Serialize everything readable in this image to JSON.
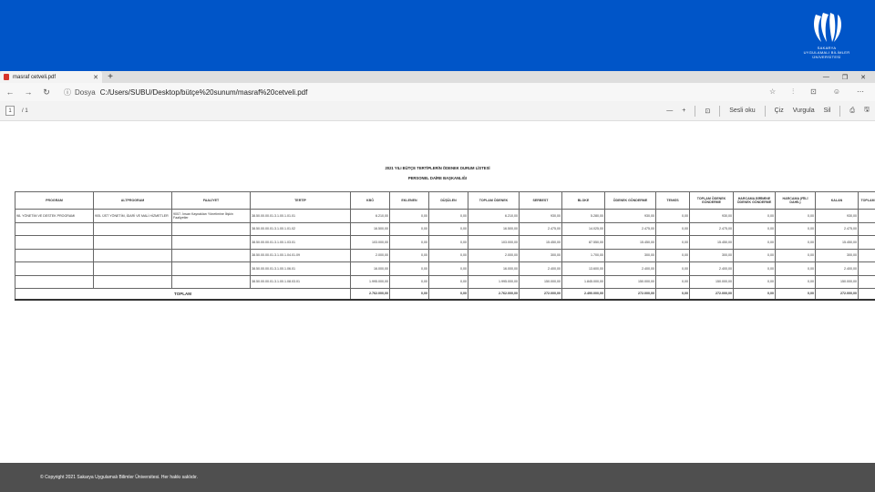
{
  "slide": {
    "logo_lines": [
      "SAKARYA",
      "UYGULAMALI BİLİMLER",
      "ÜNİVERSİTESİ"
    ],
    "footer": "© Copyright 2021 Sakarya Uygulamalı Bilimler Üniversitesi. Her hakkı saklıdır."
  },
  "browser": {
    "tab_title": "masraf cetveli.pdf",
    "tab_close": "✕",
    "new_tab": "+",
    "window_controls": [
      "—",
      "❐",
      "✕"
    ],
    "nav": {
      "back": "←",
      "forward": "→",
      "reload": "↻"
    },
    "url_info": "ⓘ",
    "url_protocol": "Dosya",
    "url": "C:/Users/SUBU/Desktop/bütçe%20sunum/masraf%20cetveli.pdf",
    "addr_icons": [
      "☆",
      "⫶",
      "⊡",
      "☺",
      "⋯"
    ],
    "page_current": "1",
    "page_total": "/ 1",
    "pdf_tools": {
      "zoom_out": "—",
      "zoom_in": "+",
      "fit": "⊡",
      "read_aloud": "Sesli oku",
      "draw": "Çiz",
      "highlight": "Vurgula",
      "erase": "Sil",
      "print": "⎙",
      "save": "🖫"
    }
  },
  "document": {
    "title": "2021 YILI BÜTÇE TERTİPLERİN ÖDENEK DURUM LİSTESİ",
    "subtitle": "PERSONEL DAİRE BAŞKANLIĞI",
    "headers": [
      "PROGRAM",
      "ALTPROGRAM",
      "FAALİYET",
      "TERTİP",
      "KBÖ",
      "EKLENEN",
      "DÜŞÜLEN",
      "TOPLAM ÖDENEK",
      "SERBEST",
      "BLOKE",
      "ÖDENEK GÖNDERME",
      "TENKİS",
      "TOPLAM ÖDENEK GÖNDERME",
      "HARCAMA BİRİMİNE ÖDENEK GÖNDERME",
      "HARCAMA (FİİLİ DAHİL)",
      "KALAN",
      "TOPLAM ÖDENEK HARCAMA"
    ],
    "program_text": "98- YÖNETİM VE DESTEK PROGRAMI",
    "altprogram_text": "905- ÜST YÖNETİM, İDARİ VE MALİ HİZMETLER",
    "faaliyet_text": "9007- İnsan Kaynakları Yönetimine İlişkin Faaliyetler",
    "rows": [
      {
        "tertip": "38.50.00.00.01.3.1.00.1.01.01",
        "kbo": "6.210,00",
        "eklenen": "0,00",
        "dusulen": "0,00",
        "toplam": "6.210,00",
        "serbest": "930,00",
        "bloke": "5.280,00",
        "gonderme": "930,00",
        "tenkis": "0,00",
        "toplam_gonderme": "930,00",
        "harcama_birimi": "0,00",
        "harcama": "0,00",
        "kalan": "930,00",
        "toplam_harcama": "6.210,00"
      },
      {
        "tertip": "38.50.00.00.01.3.1.00.1.01.02",
        "kbo": "16.500,00",
        "eklenen": "0,00",
        "dusulen": "0,00",
        "toplam": "16.500,00",
        "serbest": "2.475,00",
        "bloke": "14.025,00",
        "gonderme": "2.475,00",
        "tenkis": "0,00",
        "toplam_gonderme": "2.475,00",
        "harcama_birimi": "0,00",
        "harcama": "0,00",
        "kalan": "2.475,00",
        "toplam_harcama": "16.500,00"
      },
      {
        "tertip": "38.50.00.00.01.3.1.00.1.03.01",
        "kbo": "103.000,00",
        "eklenen": "0,00",
        "dusulen": "0,00",
        "toplam": "103.000,00",
        "serbest": "15.450,00",
        "bloke": "87.550,00",
        "gonderme": "15.450,00",
        "tenkis": "0,00",
        "toplam_gonderme": "15.450,00",
        "harcama_birimi": "0,00",
        "harcama": "0,00",
        "kalan": "15.450,00",
        "toplam_harcama": "103.000,00"
      },
      {
        "tertip": "38.50.00.00.01.3.1.00.1.04.01.09",
        "kbo": "2.000,00",
        "eklenen": "0,00",
        "dusulen": "0,00",
        "toplam": "2.000,00",
        "serbest": "300,00",
        "bloke": "1.700,00",
        "gonderme": "300,00",
        "tenkis": "0,00",
        "toplam_gonderme": "300,00",
        "harcama_birimi": "0,00",
        "harcama": "0,00",
        "kalan": "300,00",
        "toplam_harcama": "2.000,00"
      },
      {
        "tertip": "38.50.00.00.01.3.1.00.1.06.01",
        "kbo": "16.000,00",
        "eklenen": "0,00",
        "dusulen": "0,00",
        "toplam": "16.000,00",
        "serbest": "2.400,00",
        "bloke": "13.600,00",
        "gonderme": "2.400,00",
        "tenkis": "0,00",
        "toplam_gonderme": "2.400,00",
        "harcama_birimi": "0,00",
        "harcama": "0,00",
        "kalan": "2.400,00",
        "toplam_harcama": "16.000,00"
      },
      {
        "tertip": "38.50.00.00.01.3.1.00.1.08.03.01",
        "kbo": "1.995.000,00",
        "eklenen": "0,00",
        "dusulen": "0,00",
        "toplam": "1.995.000,00",
        "serbest": "150.000,00",
        "bloke": "1.845.000,00",
        "gonderme": "150.000,00",
        "tenkis": "0,00",
        "toplam_gonderme": "150.000,00",
        "harcama_birimi": "0,00",
        "harcama": "0,00",
        "kalan": "150.000,00",
        "toplam_harcama": "1.995.000,00"
      }
    ],
    "total": {
      "label": "TOPLAM",
      "kbo": "2.762.000,00",
      "eklenen": "0,00",
      "dusulen": "0,00",
      "toplam": "2.762.000,00",
      "serbest": "272.000,00",
      "bloke": "2.490.000,00",
      "gonderme": "272.000,00",
      "tenkis": "0,00",
      "toplam_gonderme": "272.000,00",
      "harcama_birimi": "0,00",
      "harcama": "0,00",
      "kalan": "272.000,00",
      "toplam_harcama": "2.762.000,00"
    }
  }
}
